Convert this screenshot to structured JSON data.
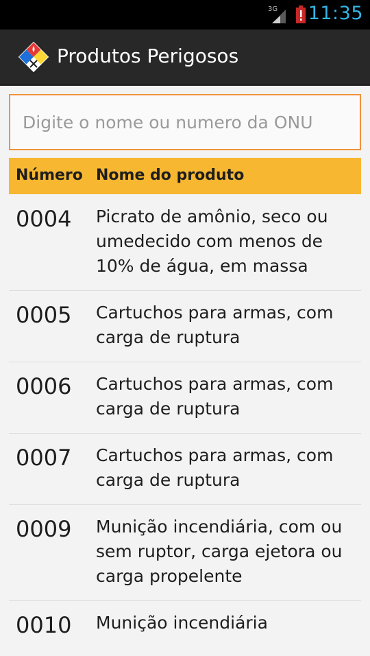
{
  "status_bar": {
    "network_label": "3G",
    "time": "11:35",
    "accent": "#33b5e5"
  },
  "action_bar": {
    "title": "Produtos Perigosos",
    "logo_icon": "hazard-diamond-icon"
  },
  "search": {
    "placeholder": "Digite o nome ou numero da ONU",
    "value": "",
    "border_color": "#f0923c"
  },
  "table": {
    "header_color": "#f7b731",
    "columns": [
      "Número",
      "Nome do produto"
    ],
    "rows": [
      {
        "numero": "0004",
        "nome": "Picrato de amônio, seco ou umedecido com menos de 10% de água, em massa"
      },
      {
        "numero": "0005",
        "nome": "Cartuchos para armas, com carga de ruptura"
      },
      {
        "numero": "0006",
        "nome": "Cartuchos para armas, com carga de ruptura"
      },
      {
        "numero": "0007",
        "nome": "Cartuchos para armas, com carga de ruptura"
      },
      {
        "numero": "0009",
        "nome": "Munição incendiária, com ou sem ruptor, carga ejetora ou carga propelente"
      },
      {
        "numero": "0010",
        "nome": "Munição incendiária"
      }
    ]
  }
}
